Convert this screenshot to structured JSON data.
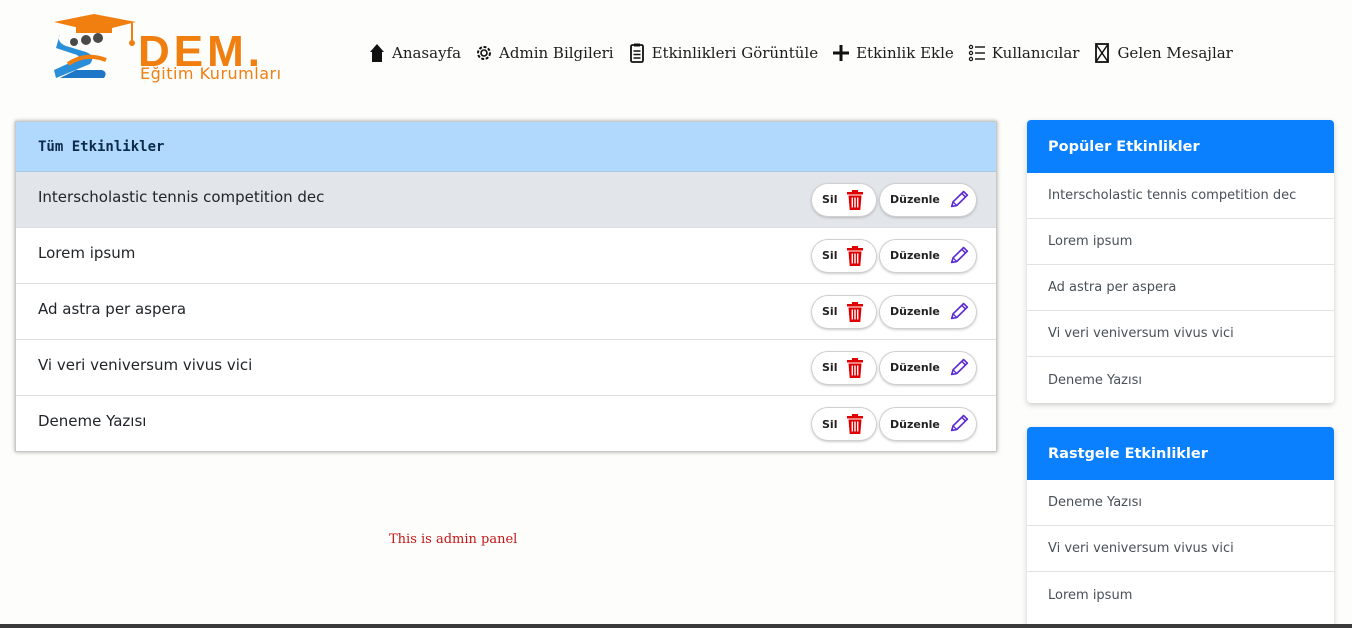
{
  "brand": {
    "name": "DEM.",
    "subtitle": "Eğitim Kurumları"
  },
  "nav": {
    "items": [
      {
        "label": "Anasayfa",
        "icon": "home-icon"
      },
      {
        "label": "Admin Bilgileri",
        "icon": "gear-icon"
      },
      {
        "label": "Etkinlikleri Görüntüle",
        "icon": "clipboard-icon"
      },
      {
        "label": "Etkinlik Ekle",
        "icon": "plus-icon"
      },
      {
        "label": "Kullanıcılar",
        "icon": "list-icon"
      },
      {
        "label": "Gelen Mesajlar",
        "icon": "hourglass-icon"
      }
    ]
  },
  "events_panel": {
    "title": "Tüm Etkinlikler",
    "delete_label": "Sil",
    "edit_label": "Düzenle",
    "rows": [
      {
        "title": "Interscholastic tennis competition dec"
      },
      {
        "title": "Lorem ipsum"
      },
      {
        "title": "Ad astra per aspera"
      },
      {
        "title": "Vi veri veniversum vivus vici"
      },
      {
        "title": "Deneme Yazısı"
      }
    ]
  },
  "admin_note": "This is admin panel",
  "popular": {
    "title": "Popüler Etkinlikler",
    "items": [
      "Interscholastic tennis competition dec",
      "Lorem ipsum",
      "Ad astra per aspera",
      "Vi veri veniversum vivus vici",
      "Deneme Yazısı"
    ]
  },
  "random": {
    "title": "Rastgele Etkinlikler",
    "items": [
      "Deneme Yazısı",
      "Vi veri veniversum vivus vici",
      "Lorem ipsum"
    ]
  },
  "colors": {
    "accent_blue": "#0a80ff",
    "panel_header": "#b1d9fd",
    "brand_orange": "#f07f10",
    "delete_red": "#e00000",
    "edit_purple": "#5b2bd6"
  }
}
